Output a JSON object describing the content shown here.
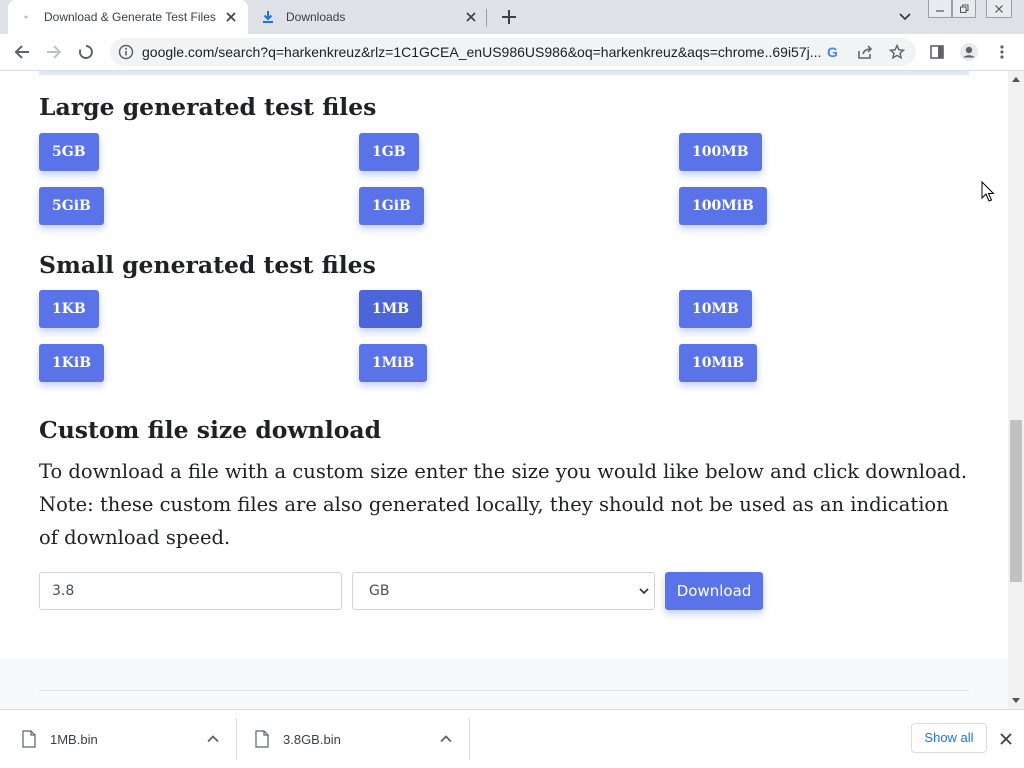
{
  "tabs": [
    {
      "title": "Download & Generate Test Files",
      "active": true
    },
    {
      "title": "Downloads",
      "active": false
    }
  ],
  "address_bar": {
    "url": "google.com/search?q=harkenkreuz&rlz=1C1GCEA_enUS986US986&oq=harkenkreuz&aqs=chrome..69i57j..."
  },
  "page": {
    "large": {
      "heading": "Large generated test files",
      "buttons": [
        "5GB",
        "1GB",
        "100MB",
        "5GiB",
        "1GiB",
        "100MiB"
      ]
    },
    "small": {
      "heading": "Small generated test files",
      "buttons": [
        "1KB",
        "1MB",
        "10MB",
        "1KiB",
        "1MiB",
        "10MiB"
      ]
    },
    "custom": {
      "heading": "Custom file size download",
      "description": "To download a file with a custom size enter the size you would like below and click download. Note: these custom files are also generated locally, they should not be used as an indication of download speed.",
      "size_value": "3.8",
      "unit_selected": "GB",
      "download_label": "Download"
    }
  },
  "downloads": {
    "items": [
      {
        "filename": "1MB.bin"
      },
      {
        "filename": "3.8GB.bin"
      }
    ],
    "show_all_label": "Show all"
  },
  "colors": {
    "accent": "#5b73e8",
    "tabstrip": "#dee1e6",
    "link": "#1a73e8"
  }
}
